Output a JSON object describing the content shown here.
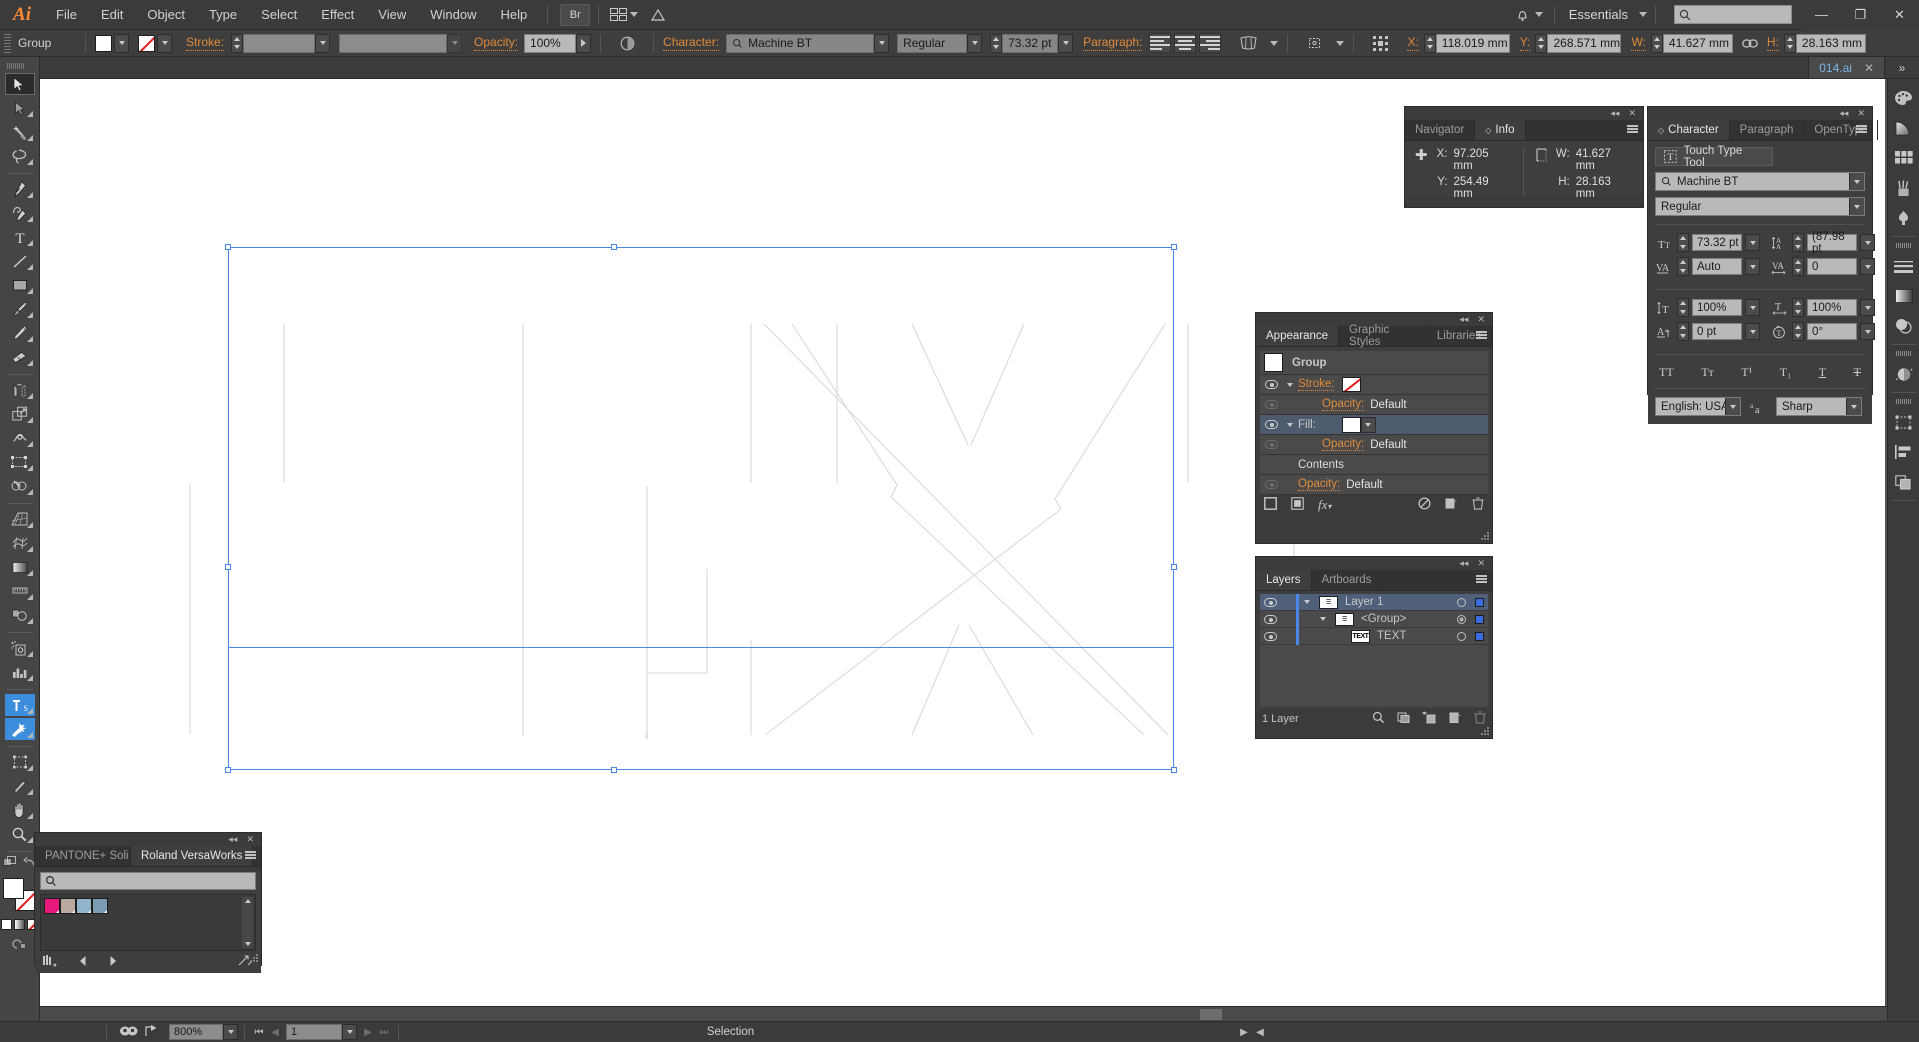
{
  "app": {
    "logo": "Ai",
    "workspace": "Essentials"
  },
  "menu": {
    "items": [
      "File",
      "Edit",
      "Object",
      "Type",
      "Select",
      "Effect",
      "View",
      "Window",
      "Help"
    ]
  },
  "menubar_right": {
    "bridge_label": "Br",
    "search_placeholder": "",
    "minimize": "—",
    "maximize": "❐",
    "close": "✕"
  },
  "control_bar": {
    "object_label": "Group",
    "stroke_label": "Stroke:",
    "stroke_weight": "",
    "stroke_profile": "",
    "opacity_label": "Opacity:",
    "opacity_value": "100%",
    "character_label": "Character:",
    "font_family": "Machine BT",
    "font_style": "Regular",
    "font_size": "73.32 pt",
    "paragraph_label": "Paragraph:",
    "x_label": "X:",
    "x_value": "118.019 mm",
    "y_label": "Y:",
    "y_value": "268.571 mm",
    "w_label": "W:",
    "w_value": "41.627 mm",
    "h_label": "H:",
    "h_value": "28.163 mm"
  },
  "document_tab": {
    "name": "014.ai",
    "close": "✕",
    "more": "»"
  },
  "toolbar": {
    "tools": [
      {
        "name": "selection-tool",
        "active": true
      },
      {
        "name": "direct-selection-tool",
        "active": false
      },
      {
        "name": "magic-wand-tool",
        "active": false
      },
      {
        "name": "lasso-tool",
        "active": false
      },
      {
        "name": "pen-tool",
        "active": false
      },
      {
        "name": "curvature-tool",
        "active": false
      },
      {
        "name": "type-tool",
        "active": false
      },
      {
        "name": "line-segment-tool",
        "active": false
      },
      {
        "name": "rectangle-tool",
        "active": false
      },
      {
        "name": "paintbrush-tool",
        "active": false
      },
      {
        "name": "pencil-tool",
        "active": false
      },
      {
        "name": "eraser-tool",
        "active": false
      },
      {
        "name": "rotate-tool",
        "active": false
      },
      {
        "name": "scale-tool",
        "active": false
      },
      {
        "name": "width-tool",
        "active": false
      },
      {
        "name": "free-transform-tool",
        "active": false
      },
      {
        "name": "shape-builder-tool",
        "active": false
      },
      {
        "name": "perspective-grid-tool",
        "active": false
      },
      {
        "name": "mesh-tool",
        "active": false
      },
      {
        "name": "gradient-tool",
        "active": false
      },
      {
        "name": "eyedropper-tool",
        "active": false
      },
      {
        "name": "blend-tool",
        "active": false
      },
      {
        "name": "symbol-sprayer-tool",
        "active": false
      },
      {
        "name": "column-graph-tool",
        "active": false
      },
      {
        "name": "artboard-tool",
        "active": false
      },
      {
        "name": "slice-tool",
        "active": false
      },
      {
        "name": "hand-tool",
        "active": false
      },
      {
        "name": "zoom-tool",
        "active": false
      }
    ]
  },
  "info_panel": {
    "tabs": [
      "Navigator",
      "Info"
    ],
    "active_tab": "Info",
    "x_label": "X:",
    "x_value": "97.205 mm",
    "y_label": "Y:",
    "y_value": "254.49 mm",
    "w_label": "W:",
    "w_value": "41.627 mm",
    "h_label": "H:",
    "h_value": "28.163 mm"
  },
  "appearance_panel": {
    "tabs": [
      "Appearance",
      "Graphic Styles",
      "Libraries"
    ],
    "active_tab": "Appearance",
    "target_label": "Group",
    "rows": [
      {
        "label": "Stroke:",
        "value": "",
        "type": "stroke"
      },
      {
        "label": "Opacity:",
        "value": "Default",
        "type": "opacity"
      },
      {
        "label": "Fill:",
        "value": "",
        "type": "fill"
      },
      {
        "label": "Opacity:",
        "value": "Default",
        "type": "opacity"
      },
      {
        "label": "Contents",
        "value": "",
        "type": "contents"
      },
      {
        "label": "Opacity:",
        "value": "Default",
        "type": "opacity"
      }
    ]
  },
  "layers_panel": {
    "tabs": [
      "Layers",
      "Artboards"
    ],
    "active_tab": "Layers",
    "rows": [
      {
        "name": "Layer 1",
        "thumb": "☰",
        "indent": 0,
        "selected": true
      },
      {
        "name": "<Group>",
        "thumb": "☰",
        "indent": 1,
        "selected": false
      },
      {
        "name": "TEXT",
        "thumb": "TEXT",
        "indent": 2,
        "selected": false
      }
    ],
    "footer_count": "1 Layer"
  },
  "swatches_panel": {
    "tabs": [
      "PANTONE+ Soli",
      "Roland VersaWorks"
    ],
    "active_tab": "Roland VersaWorks",
    "search_placeholder": "",
    "swatches": [
      "#e8197d",
      "#b8a8a0",
      "#8fb4cc",
      "#7d9cb4"
    ]
  },
  "character_panel": {
    "tabs": [
      "Character",
      "Paragraph",
      "OpenType"
    ],
    "active_tab": "Character",
    "touch_type_tool": "Touch Type Tool",
    "font_family": "Machine BT",
    "font_style": "Regular",
    "font_size": "73.32 pt",
    "leading": "(87.98 pt",
    "kerning": "Auto",
    "tracking": "0",
    "vertical_scale": "100%",
    "horizontal_scale": "100%",
    "baseline_shift": "0 pt",
    "character_rotation": "0°",
    "style_buttons": [
      "TT",
      "Tᴛ",
      "T¹",
      "T₁",
      "T",
      "T"
    ],
    "language": "English: USA",
    "anti_aliasing": "Sharp"
  },
  "status_bar": {
    "zoom": "800%",
    "artboard_number": "1",
    "tool_status": "Selection"
  },
  "colors": {
    "accent_orange": "#e08b3a",
    "selection_blue": "#4a86e8",
    "panel_bg": "#3e3e3e",
    "chrome_bg": "#3b3b3b",
    "canvas_bg": "#535353",
    "artboard_white": "#ffffff",
    "tool_highlight": "#3c8ddb"
  },
  "artwork": {
    "description": "white-outlined-letterforms",
    "stroke_color": "#d8d8d8"
  }
}
